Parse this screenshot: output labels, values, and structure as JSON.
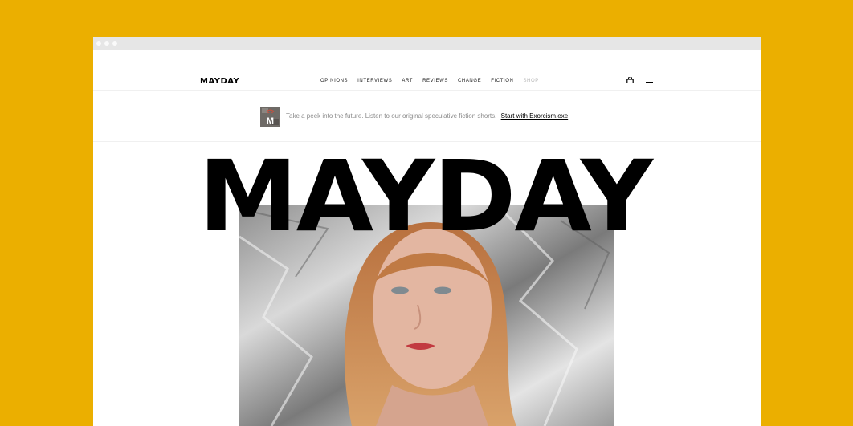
{
  "site": {
    "logo": "MAYDAY",
    "masthead": "MAYDAY"
  },
  "nav": {
    "items": [
      {
        "label": "OPINIONS"
      },
      {
        "label": "INTERVIEWS"
      },
      {
        "label": "ART"
      },
      {
        "label": "REVIEWS"
      },
      {
        "label": "CHANGE"
      },
      {
        "label": "FICTION"
      },
      {
        "label": "SHOP"
      }
    ]
  },
  "icons": {
    "cart": "cart-icon",
    "menu": "menu-icon",
    "thumb_letter": "M"
  },
  "promo": {
    "text": "Take a peek into the future. Listen to our original speculative fiction shorts.",
    "link": "Start with Exorcism.exe"
  },
  "colors": {
    "background": "#ebaf00",
    "ink": "#000000",
    "muted": "#b8b8b8"
  }
}
